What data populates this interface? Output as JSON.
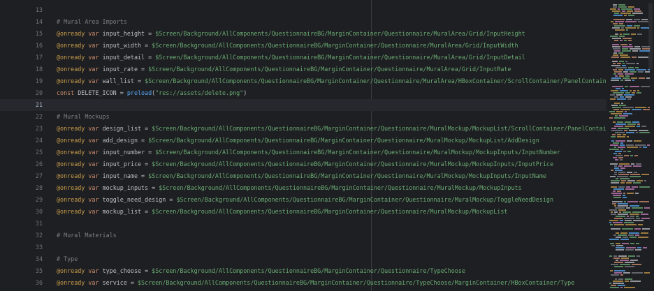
{
  "lines": [
    {
      "num": "13",
      "tokens": []
    },
    {
      "num": "14",
      "tokens": [
        {
          "c": "comment",
          "t": "# Mural Area Imports"
        }
      ]
    },
    {
      "num": "15",
      "tokens": [
        {
          "c": "anno",
          "t": "@onready"
        },
        {
          "c": "op",
          "t": " "
        },
        {
          "c": "kw",
          "t": "var"
        },
        {
          "c": "id",
          "t": " input_height = "
        },
        {
          "c": "path",
          "t": "$Screen/Background/AllComponents/QuestionnaireBG/MarginContainer/Questionnaire/MuralArea/Grid/InputHeight"
        }
      ]
    },
    {
      "num": "16",
      "tokens": [
        {
          "c": "anno",
          "t": "@onready"
        },
        {
          "c": "op",
          "t": " "
        },
        {
          "c": "kw",
          "t": "var"
        },
        {
          "c": "id",
          "t": " input_width = "
        },
        {
          "c": "path",
          "t": "$Screen/Background/AllComponents/QuestionnaireBG/MarginContainer/Questionnaire/MuralArea/Grid/InputWidth"
        }
      ]
    },
    {
      "num": "17",
      "tokens": [
        {
          "c": "anno",
          "t": "@onready"
        },
        {
          "c": "op",
          "t": " "
        },
        {
          "c": "kw",
          "t": "var"
        },
        {
          "c": "id",
          "t": " input_detail = "
        },
        {
          "c": "path",
          "t": "$Screen/Background/AllComponents/QuestionnaireBG/MarginContainer/Questionnaire/MuralArea/Grid/InputDetail"
        }
      ]
    },
    {
      "num": "18",
      "tokens": [
        {
          "c": "anno",
          "t": "@onready"
        },
        {
          "c": "op",
          "t": " "
        },
        {
          "c": "kw",
          "t": "var"
        },
        {
          "c": "id",
          "t": " input_rate = "
        },
        {
          "c": "path",
          "t": "$Screen/Background/AllComponents/QuestionnaireBG/MarginContainer/Questionnaire/MuralArea/Grid/InputRate"
        }
      ]
    },
    {
      "num": "19",
      "tokens": [
        {
          "c": "anno",
          "t": "@onready"
        },
        {
          "c": "op",
          "t": " "
        },
        {
          "c": "kw",
          "t": "var"
        },
        {
          "c": "id",
          "t": " wall_list = "
        },
        {
          "c": "path",
          "t": "$Screen/Background/AllComponents/QuestionnaireBG/MarginContainer/Questionnaire/MuralArea/HBoxContainer/ScrollContainer/PanelContainer/WallL"
        }
      ]
    },
    {
      "num": "20",
      "tokens": [
        {
          "c": "kw",
          "t": "const"
        },
        {
          "c": "id",
          "t": " DELETE_ICON = "
        },
        {
          "c": "fn",
          "t": "preload"
        },
        {
          "c": "op",
          "t": "("
        },
        {
          "c": "str",
          "t": "\"res://assets/delete.png\""
        },
        {
          "c": "op",
          "t": ")"
        }
      ]
    },
    {
      "num": "21",
      "tokens": [],
      "current": true
    },
    {
      "num": "22",
      "tokens": [
        {
          "c": "comment",
          "t": "# Mural Mockups"
        }
      ]
    },
    {
      "num": "23",
      "tokens": [
        {
          "c": "anno",
          "t": "@onready"
        },
        {
          "c": "op",
          "t": " "
        },
        {
          "c": "kw",
          "t": "var"
        },
        {
          "c": "id",
          "t": " design_list = "
        },
        {
          "c": "path",
          "t": "$Screen/Background/AllComponents/QuestionnaireBG/MarginContainer/Questionnaire/MuralMockup/MockupList/ScrollContainer/PanelContainer/Desi"
        }
      ]
    },
    {
      "num": "24",
      "tokens": [
        {
          "c": "anno",
          "t": "@onready"
        },
        {
          "c": "op",
          "t": " "
        },
        {
          "c": "kw",
          "t": "var"
        },
        {
          "c": "id",
          "t": " add_design = "
        },
        {
          "c": "path",
          "t": "$Screen/Background/AllComponents/QuestionnaireBG/MarginContainer/Questionnaire/MuralMockup/MockupList/AddDesign"
        }
      ]
    },
    {
      "num": "25",
      "tokens": [
        {
          "c": "anno",
          "t": "@onready"
        },
        {
          "c": "op",
          "t": " "
        },
        {
          "c": "kw",
          "t": "var"
        },
        {
          "c": "id",
          "t": " input_number = "
        },
        {
          "c": "path",
          "t": "$Screen/Background/AllComponents/QuestionnaireBG/MarginContainer/Questionnaire/MuralMockup/MockupInputs/InputNumber"
        }
      ]
    },
    {
      "num": "26",
      "tokens": [
        {
          "c": "anno",
          "t": "@onready"
        },
        {
          "c": "op",
          "t": " "
        },
        {
          "c": "kw",
          "t": "var"
        },
        {
          "c": "id",
          "t": " input_price = "
        },
        {
          "c": "path",
          "t": "$Screen/Background/AllComponents/QuestionnaireBG/MarginContainer/Questionnaire/MuralMockup/MockupInputs/InputPrice"
        }
      ]
    },
    {
      "num": "27",
      "tokens": [
        {
          "c": "anno",
          "t": "@onready"
        },
        {
          "c": "op",
          "t": " "
        },
        {
          "c": "kw",
          "t": "var"
        },
        {
          "c": "id",
          "t": " input_name = "
        },
        {
          "c": "path",
          "t": "$Screen/Background/AllComponents/QuestionnaireBG/MarginContainer/Questionnaire/MuralMockup/MockupInputs/InputName"
        }
      ]
    },
    {
      "num": "28",
      "tokens": [
        {
          "c": "anno",
          "t": "@onready"
        },
        {
          "c": "op",
          "t": " "
        },
        {
          "c": "kw",
          "t": "var"
        },
        {
          "c": "id",
          "t": " mockup_inputs = "
        },
        {
          "c": "path",
          "t": "$Screen/Background/AllComponents/QuestionnaireBG/MarginContainer/Questionnaire/MuralMockup/MockupInputs"
        }
      ]
    },
    {
      "num": "29",
      "tokens": [
        {
          "c": "anno",
          "t": "@onready"
        },
        {
          "c": "op",
          "t": " "
        },
        {
          "c": "kw",
          "t": "var"
        },
        {
          "c": "id",
          "t": " toggle_need_design = "
        },
        {
          "c": "path",
          "t": "$Screen/Background/AllComponents/QuestionnaireBG/MarginContainer/Questionnaire/MuralMockup/ToggleNeedDesign"
        }
      ]
    },
    {
      "num": "30",
      "tokens": [
        {
          "c": "anno",
          "t": "@onready"
        },
        {
          "c": "op",
          "t": " "
        },
        {
          "c": "kw",
          "t": "var"
        },
        {
          "c": "id",
          "t": " mockup_list = "
        },
        {
          "c": "path",
          "t": "$Screen/Background/AllComponents/QuestionnaireBG/MarginContainer/Questionnaire/MuralMockup/MockupList"
        }
      ]
    },
    {
      "num": "31",
      "tokens": []
    },
    {
      "num": "32",
      "tokens": [
        {
          "c": "comment",
          "t": "# Mural Materials"
        }
      ]
    },
    {
      "num": "33",
      "tokens": []
    },
    {
      "num": "34",
      "tokens": [
        {
          "c": "comment",
          "t": "# Type"
        }
      ]
    },
    {
      "num": "35",
      "tokens": [
        {
          "c": "anno",
          "t": "@onready"
        },
        {
          "c": "op",
          "t": " "
        },
        {
          "c": "kw",
          "t": "var"
        },
        {
          "c": "id",
          "t": " type_choose = "
        },
        {
          "c": "path",
          "t": "$Screen/Background/AllComponents/QuestionnaireBG/MarginContainer/Questionnaire/TypeChoose"
        }
      ]
    },
    {
      "num": "36",
      "tokens": [
        {
          "c": "anno",
          "t": "@onready"
        },
        {
          "c": "op",
          "t": " "
        },
        {
          "c": "kw",
          "t": "var"
        },
        {
          "c": "id",
          "t": " service = "
        },
        {
          "c": "path",
          "t": "$Screen/Background/AllComponents/QuestionnaireBG/MarginContainer/Questionnaire/TypeChoose/MarginContainer/HBoxContainer/Type"
        }
      ]
    }
  ],
  "colors": {
    "background": "#1e1f22",
    "comment": "#7a7e85",
    "annotation": "#c79b4a",
    "keyword": "#cf8e6d",
    "path": "#6aab73",
    "function": "#56a8f5"
  }
}
